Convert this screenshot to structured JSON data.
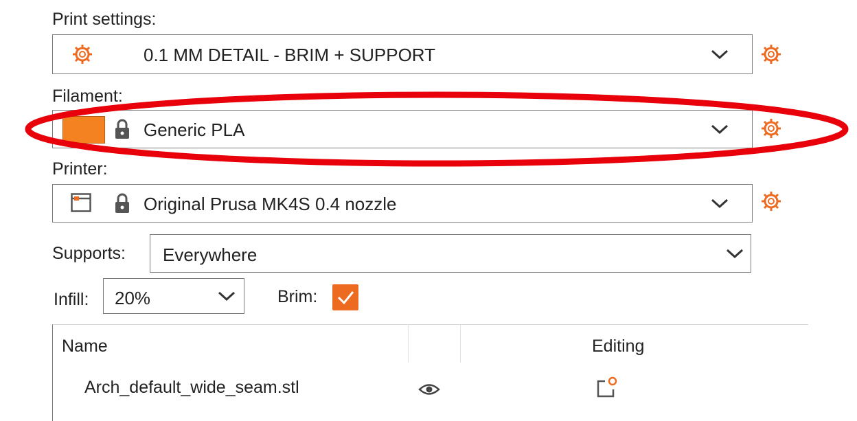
{
  "print_settings": {
    "label": "Print settings:",
    "value": "0.1 MM DETAIL - BRIM + SUPPORT",
    "icon": "gear-icon"
  },
  "filament": {
    "label": "Filament:",
    "value": "Generic PLA",
    "color": "#f58220",
    "icon": "lock-icon"
  },
  "printer": {
    "label": "Printer:",
    "value": "Original Prusa MK4S 0.4 nozzle",
    "icon": "printer-icon"
  },
  "supports": {
    "label": "Supports:",
    "value": "Everywhere"
  },
  "infill": {
    "label": "Infill:",
    "value": "20%"
  },
  "brim": {
    "label": "Brim:",
    "checked": true
  },
  "object_list": {
    "columns": [
      "Name",
      "",
      "Editing"
    ],
    "rows": [
      {
        "name": "Arch_default_wide_seam.stl",
        "visible_icon": "eye-icon",
        "editing_icon": "edit-settings-icon"
      }
    ]
  },
  "accent_color": "#ed6b21",
  "highlight_color": "#e8000b"
}
